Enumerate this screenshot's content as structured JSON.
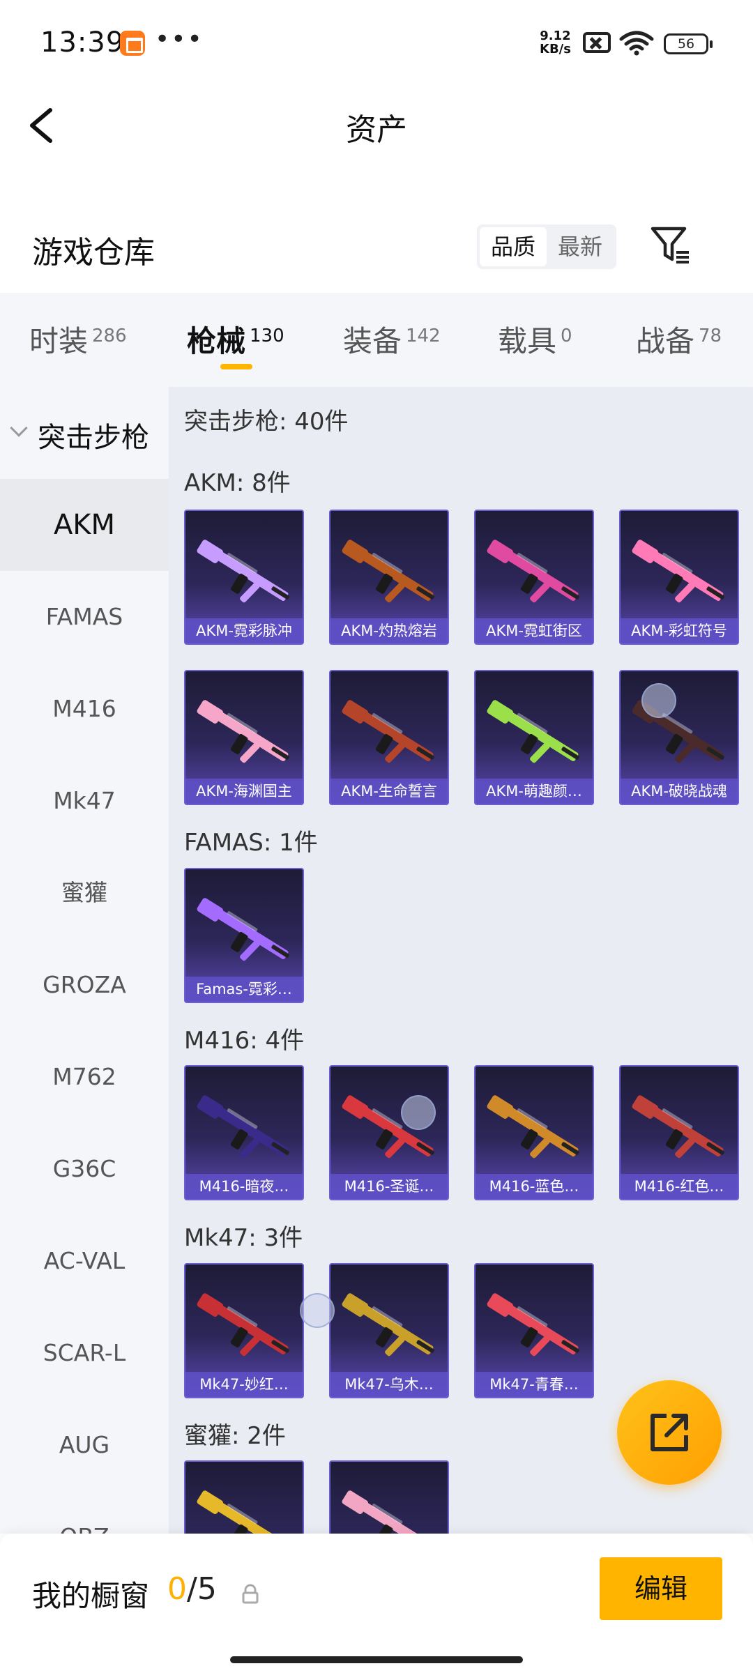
{
  "status_bar": {
    "time": "13:39",
    "dots": "•••",
    "net_speed": "9.12",
    "net_unit": "KB/s",
    "battery": "56"
  },
  "header": {
    "title": "资产",
    "back_icon": "chevron-left-icon"
  },
  "warehouse": {
    "title": "游戏仓库",
    "sort_options": [
      "品质",
      "最新"
    ],
    "sort_selected": "品质",
    "filter_icon": "filter-icon"
  },
  "tabs": [
    {
      "label": "时装",
      "count": "286"
    },
    {
      "label": "枪械",
      "count": "130",
      "active": true
    },
    {
      "label": "装备",
      "count": "142"
    },
    {
      "label": "载具",
      "count": "0"
    },
    {
      "label": "战备",
      "count": "78"
    }
  ],
  "sidebar": {
    "header": "突击步枪",
    "items": [
      "AKM",
      "FAMAS",
      "M416",
      "Mk47",
      "蜜獾",
      "GROZA",
      "M762",
      "G36C",
      "AC-VAL",
      "SCAR-L",
      "AUG",
      "QBZ"
    ],
    "active": "AKM"
  },
  "content": {
    "section_total": "突击步枪: 40件",
    "groups": [
      {
        "title": "AKM: 8件",
        "items": [
          "AKM-霓彩脉冲",
          "AKM-灼热熔岩",
          "AKM-霓虹街区",
          "AKM-彩虹符号",
          "AKM-海渊国主",
          "AKM-生命誓言",
          "AKM-萌趣颜…",
          "AKM-破晓战魂"
        ]
      },
      {
        "title": "FAMAS: 1件",
        "items": [
          "Famas-霓彩…"
        ]
      },
      {
        "title": "M416: 4件",
        "items": [
          "M416-暗夜…",
          "M416-圣诞…",
          "M416-蓝色…",
          "M416-红色…"
        ]
      },
      {
        "title": "Mk47: 3件",
        "items": [
          "Mk47-妙红…",
          "Mk47-乌木…",
          "Mk47-青春…"
        ]
      },
      {
        "title": "蜜獾: 2件",
        "items": [
          "",
          ""
        ]
      }
    ]
  },
  "colors": {
    "accent": "#ffb400",
    "card_top": "#1e1b36",
    "card_bottom": "#5b48b3",
    "gun_colors": [
      "#c79cff",
      "#b8591f",
      "#e04aa0",
      "#ff7ab6",
      "#f6a6c8",
      "#b5452a",
      "#9be04a",
      "#4a2a2a",
      "#a36cff",
      "#3a2a8a",
      "#d9383f",
      "#d08a2a",
      "#c0403a",
      "#c73035",
      "#c9a12a",
      "#e84a5a",
      "#e6b92a",
      "#f2a6c4"
    ]
  },
  "fab": {
    "icon": "external-link-icon"
  },
  "bottom_bar": {
    "label": "我的橱窗",
    "count_current": "0",
    "count_sep_total": "/5",
    "lock_icon": "lock-icon",
    "edit_label": "编辑"
  }
}
